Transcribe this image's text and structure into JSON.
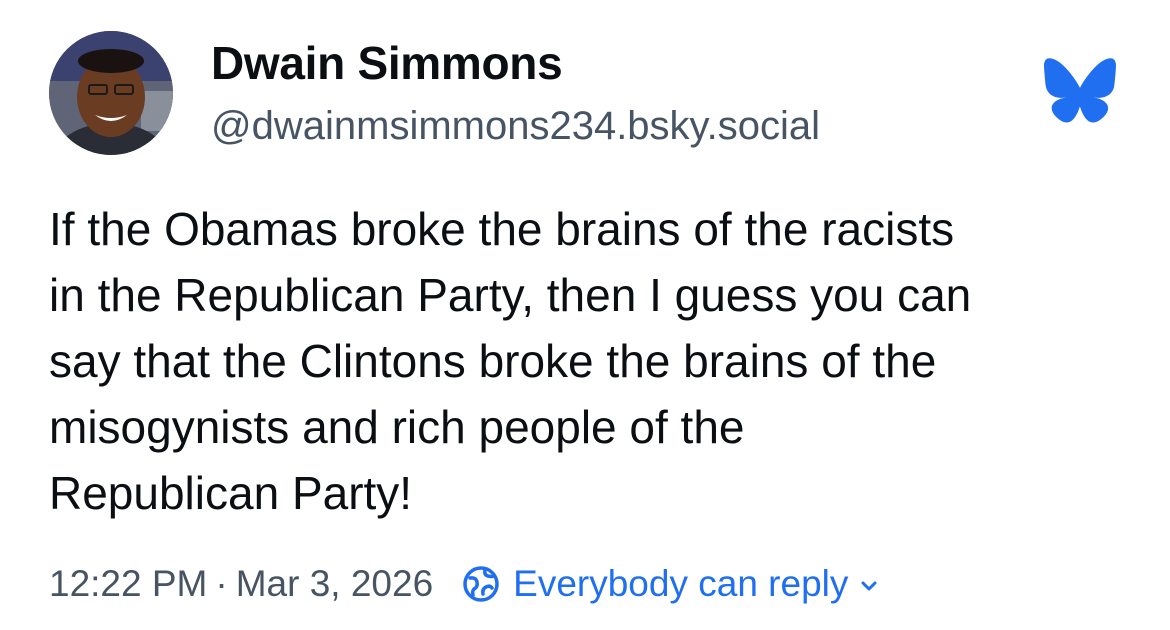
{
  "author": {
    "display_name": "Dwain Simmons",
    "handle": "@dwainmsimmons234.bsky.social",
    "avatar_icon": "user-avatar-photo"
  },
  "brand": {
    "logo_icon": "bluesky-butterfly-icon",
    "accent_color": "#1f6ff0"
  },
  "post": {
    "text": "If the Obamas broke the brains of the racists\nin the Republican Party, then I guess you can\nsay that the Clintons broke the brains of the\nmisogynists and rich people of the\nRepublican Party!"
  },
  "meta": {
    "time": "12:22 PM",
    "separator": "·",
    "date": "Mar 3, 2026",
    "reply_setting": "Everybody can reply",
    "reply_icon": "globe-icon",
    "chevron_icon": "chevron-down-icon"
  }
}
